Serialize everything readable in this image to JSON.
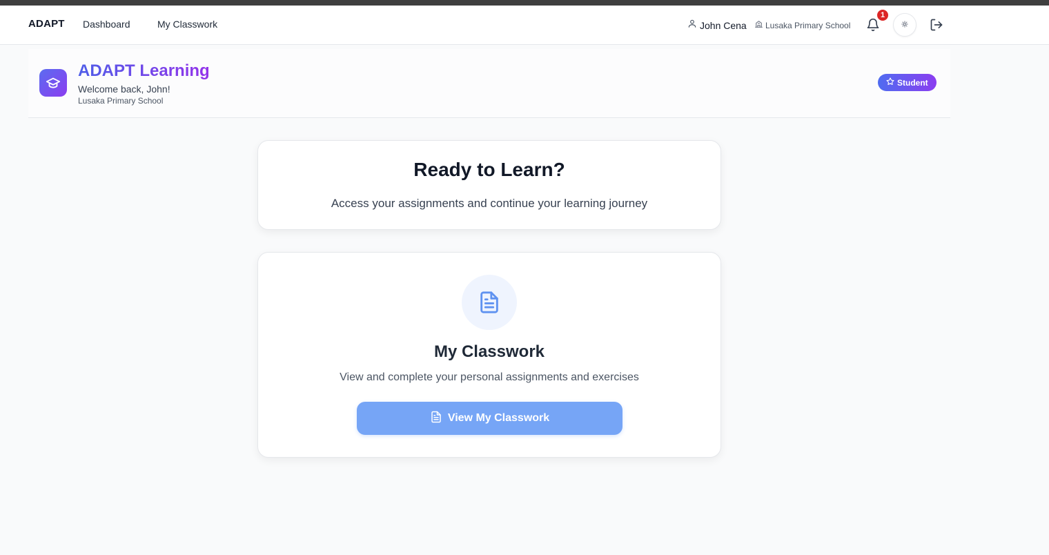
{
  "nav": {
    "brand": "ADAPT",
    "links": [
      {
        "label": "Dashboard"
      },
      {
        "label": "My Classwork"
      }
    ],
    "user_name": "John Cena",
    "school": "Lusaka Primary School",
    "notification_count": "1",
    "icons": [
      "user-icon",
      "school-icon",
      "bell-icon",
      "theme-icon",
      "logout-icon"
    ]
  },
  "header": {
    "title": "ADAPT Learning",
    "welcome": "Welcome back, John!",
    "school": "Lusaka Primary School",
    "role": "Student",
    "icons": [
      "graduation-cap-icon",
      "star-icon"
    ]
  },
  "ready_card": {
    "title": "Ready to Learn?",
    "subtitle": "Access your assignments and continue your learning journey"
  },
  "classwork_card": {
    "title": "My Classwork",
    "subtitle": "View and complete your personal assignments and exercises",
    "button_label": "View My Classwork",
    "icons": [
      "document-icon"
    ]
  },
  "colors": {
    "brand_gradient_start": "#4f5ee8",
    "brand_gradient_end": "#9333ea",
    "badge_red": "#dc2626",
    "cta_blue": "#76a5f6",
    "doc_icon_blue": "#5f92f0",
    "page_bg": "#f9fafb"
  }
}
